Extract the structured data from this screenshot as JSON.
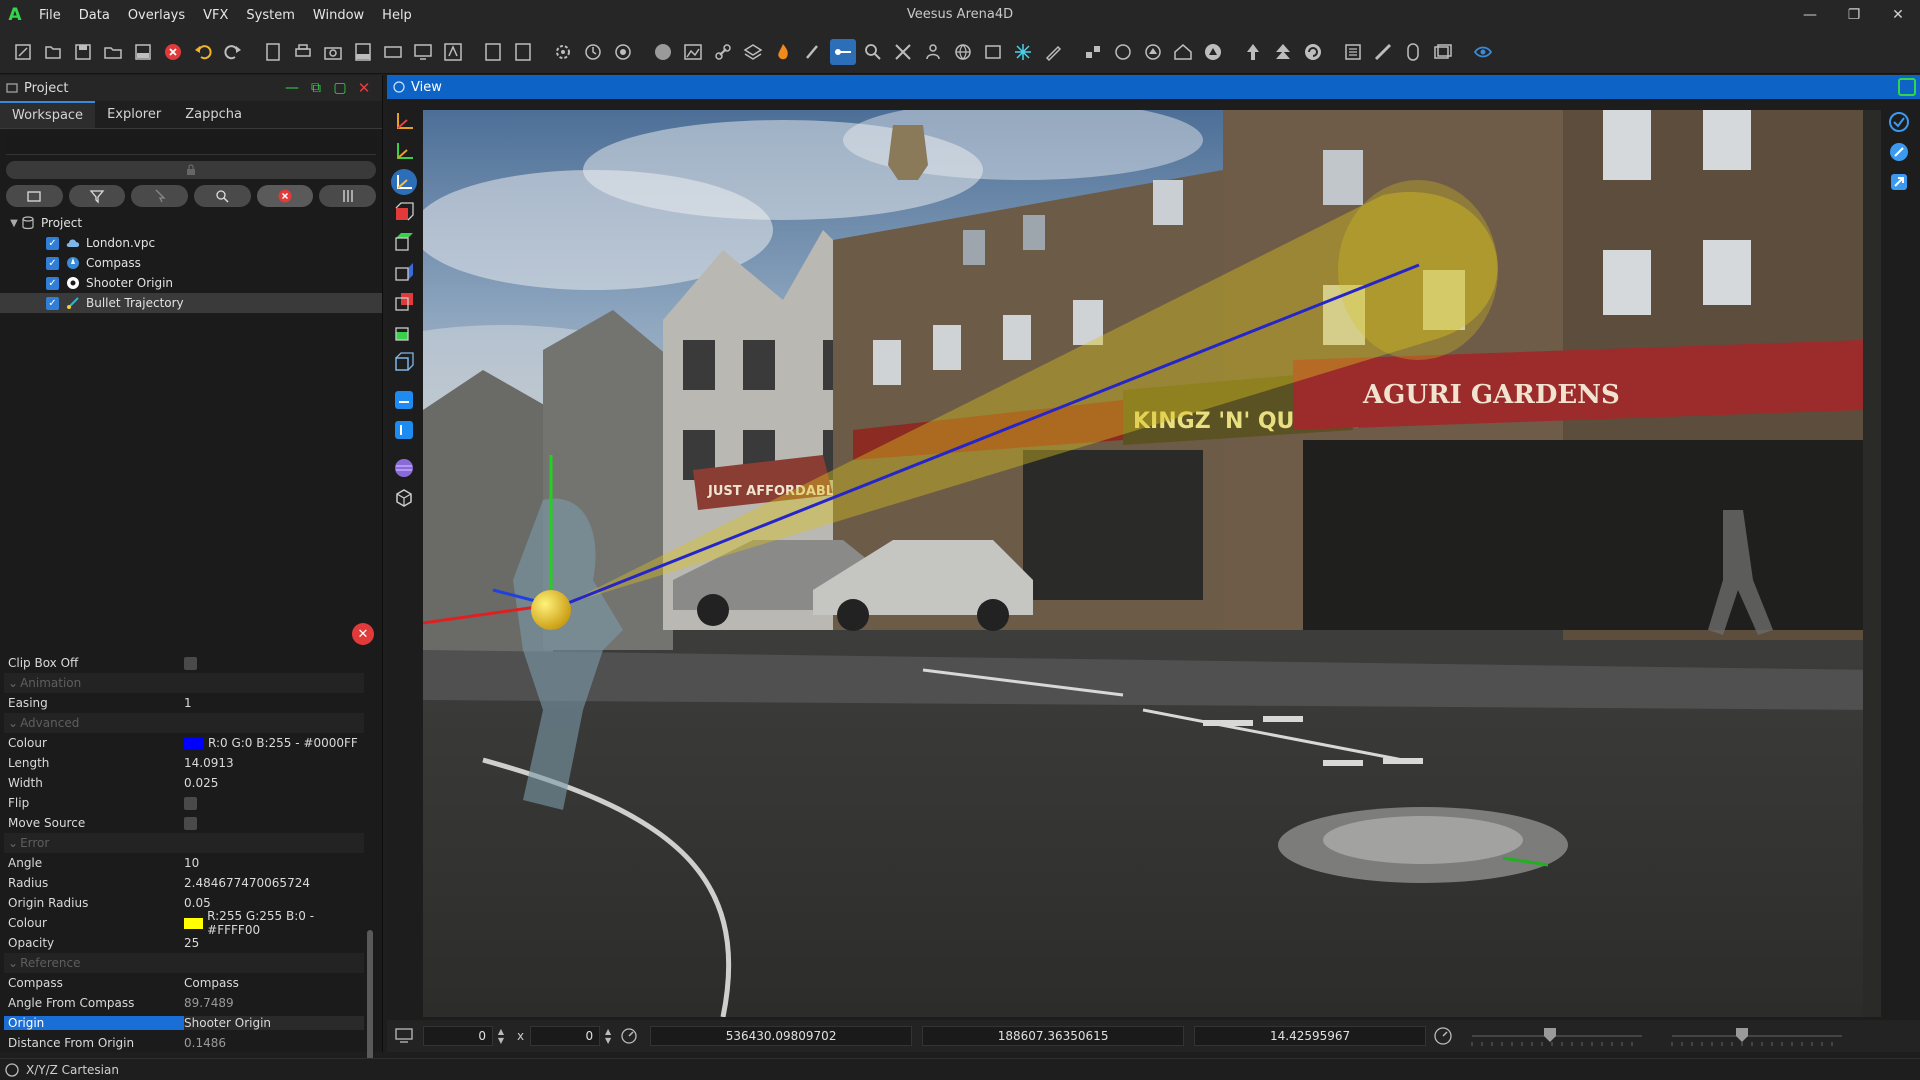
{
  "app": {
    "title": "Veesus Arena4D",
    "logo": "A",
    "menu": [
      "File",
      "Data",
      "Overlays",
      "VFX",
      "System",
      "Window",
      "Help"
    ]
  },
  "project_panel": {
    "title": "Project",
    "tabs": [
      "Workspace",
      "Explorer",
      "Zappcha"
    ],
    "active_tab": "Workspace",
    "tree": {
      "root": "Project",
      "items": [
        {
          "label": "London.vpc",
          "icon": "cloud-icon",
          "checked": true
        },
        {
          "label": "Compass",
          "icon": "compass-icon",
          "checked": true
        },
        {
          "label": "Shooter Origin",
          "icon": "target-icon",
          "checked": true
        },
        {
          "label": "Bullet Trajectory",
          "icon": "trajectory-icon",
          "checked": true,
          "selected": true
        }
      ]
    }
  },
  "properties": [
    {
      "key": "Clip Box Off",
      "type": "checkbox",
      "checked": false
    },
    {
      "key": "Animation",
      "type": "section"
    },
    {
      "key": "Easing",
      "value": "1"
    },
    {
      "key": "Advanced",
      "type": "section"
    },
    {
      "key": "Colour",
      "value": "R:0 G:0 B:255 - #0000FF",
      "swatch": "#0000FF"
    },
    {
      "key": "Length",
      "value": "14.0913"
    },
    {
      "key": "Width",
      "value": "0.025"
    },
    {
      "key": "Flip",
      "type": "checkbox",
      "checked": false
    },
    {
      "key": "Move Source",
      "type": "checkbox",
      "checked": false
    },
    {
      "key": "Error",
      "type": "section"
    },
    {
      "key": "Angle",
      "value": "10"
    },
    {
      "key": "Radius",
      "value": "2.484677470065724"
    },
    {
      "key": "Origin Radius",
      "value": "0.05"
    },
    {
      "key": "Colour",
      "value": "R:255 G:255 B:0 - #FFFF00",
      "swatch": "#FFFF00"
    },
    {
      "key": "Opacity",
      "value": "25"
    },
    {
      "key": "Reference",
      "type": "section"
    },
    {
      "key": "Compass",
      "value": "Compass"
    },
    {
      "key": "Angle From Compass",
      "value": "89.7489",
      "muted": true
    },
    {
      "key": "Origin",
      "value": "Shooter Origin",
      "selected": true
    },
    {
      "key": "Distance From Origin",
      "value": "0.1486",
      "muted": true
    }
  ],
  "view_panel": {
    "title": "View",
    "footer": {
      "width_value": "0",
      "height_value": "0",
      "times_label": "x",
      "coord_x": "536430.09809702",
      "coord_y": "188607.36350615",
      "coord_z": "14.42595967"
    }
  },
  "statusbar": {
    "text": "X/Y/Z Cartesian"
  },
  "scene_signs": {
    "sign_left": "JUST AFFORDABLE",
    "sign_center": "KINGZ 'N' QUEENZ",
    "sign_right": "AGURI GARDENS"
  },
  "colors": {
    "trajectory": "#0000FF",
    "error_cone": "#FFFF00",
    "accent": "#0e63c7",
    "green_accent": "#33d64a"
  }
}
